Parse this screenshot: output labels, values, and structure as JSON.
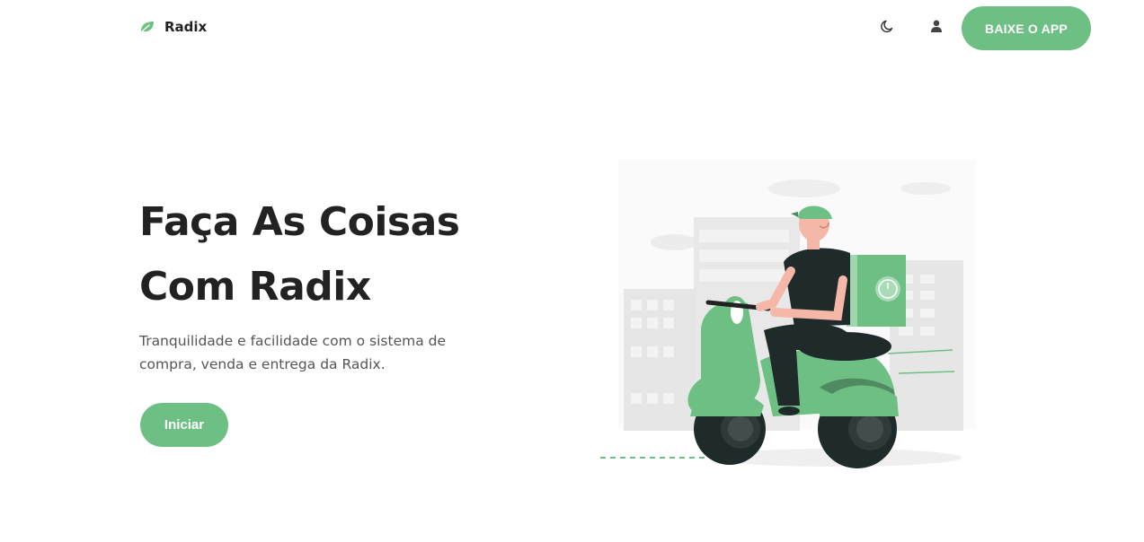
{
  "header": {
    "brand": "Radix",
    "download_label": "BAIXE O APP"
  },
  "icons": {
    "logo": "leaf-icon",
    "theme_toggle": "moon-icon",
    "account": "user-icon"
  },
  "hero": {
    "title_line1": "Faça As Coisas",
    "title_line2": "Com Radix",
    "subtitle": "Tranquilidade e facilidade com o sistema de compra, venda e entrega da Radix.",
    "cta_label": "Iniciar"
  },
  "colors": {
    "accent": "#6dbf84",
    "text": "#222222",
    "muted": "#555555"
  }
}
